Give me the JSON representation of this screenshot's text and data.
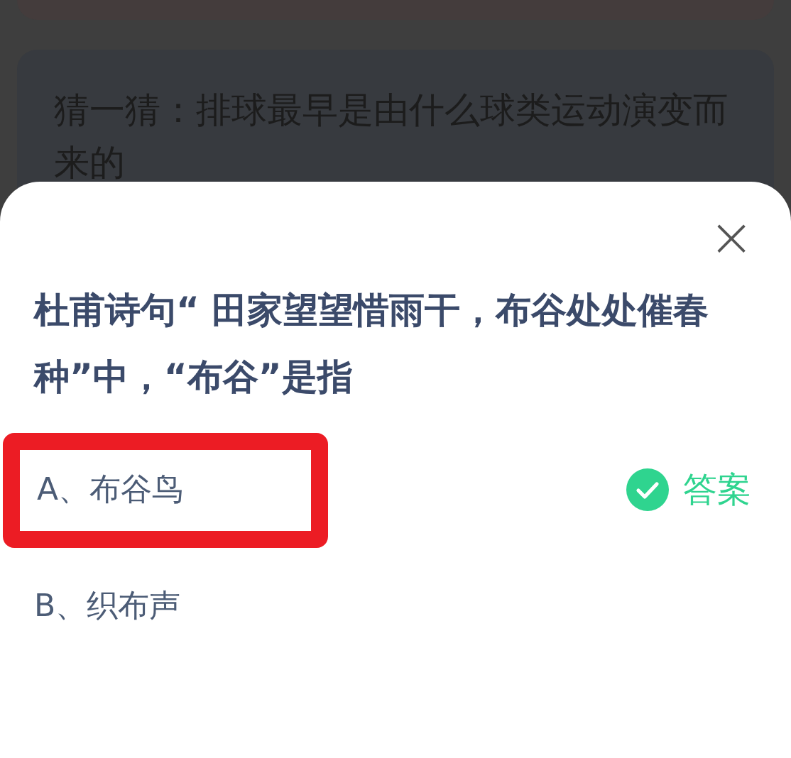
{
  "background_card": {
    "title": "猜一猜：排球最早是由什么球类运动演变而来的"
  },
  "dialog": {
    "close": "×",
    "question": "杜甫诗句“ 田家望望惜雨干，布谷处处催春种”中，“布谷”是指",
    "options": [
      {
        "label": "A、布谷鸟",
        "highlighted": true,
        "correct": true,
        "answer_label": "答案"
      },
      {
        "label": "B、织布声",
        "highlighted": false,
        "correct": false
      }
    ]
  }
}
